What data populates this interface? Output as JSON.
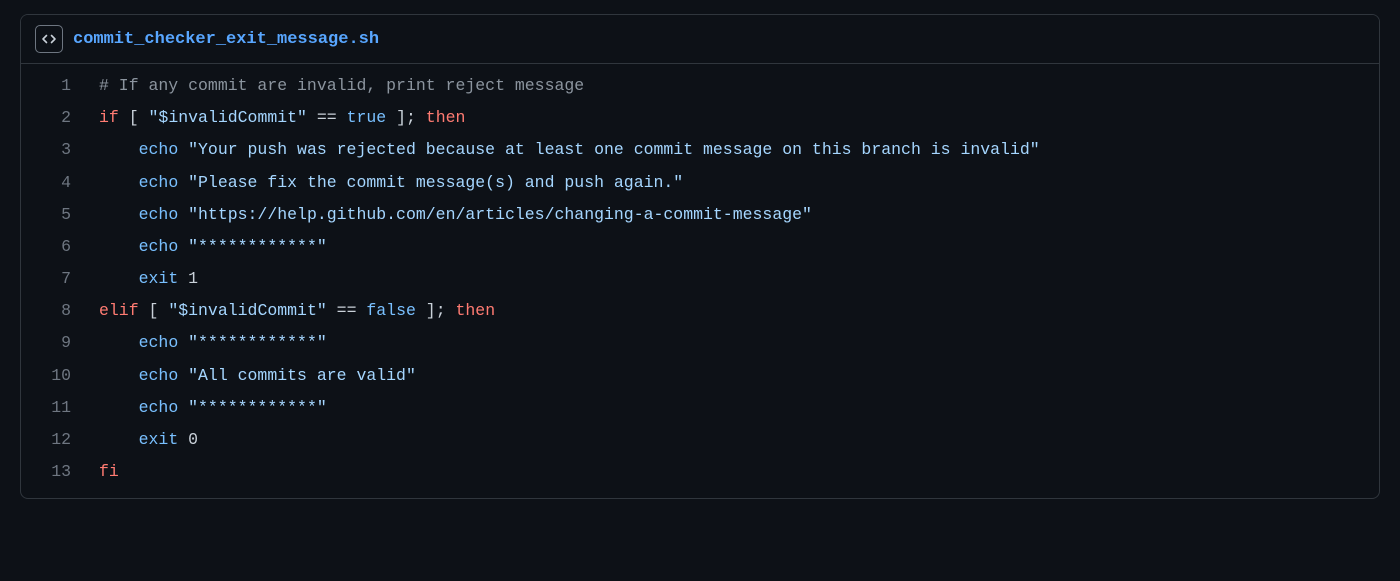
{
  "file": {
    "name": "commit_checker_exit_message.sh"
  },
  "code": {
    "lines": [
      {
        "n": "1",
        "tokens": [
          {
            "cls": "tok-comment",
            "text": "# If any commit are invalid, print reject message"
          }
        ]
      },
      {
        "n": "2",
        "tokens": [
          {
            "cls": "tok-kw",
            "text": "if"
          },
          {
            "cls": "tok-plain",
            "text": " [ "
          },
          {
            "cls": "tok-str",
            "text": "\"$invalidCommit\""
          },
          {
            "cls": "tok-plain",
            "text": " == "
          },
          {
            "cls": "tok-const",
            "text": "true"
          },
          {
            "cls": "tok-plain",
            "text": " ]; "
          },
          {
            "cls": "tok-kw",
            "text": "then"
          }
        ]
      },
      {
        "n": "3",
        "tokens": [
          {
            "cls": "tok-plain",
            "text": "    "
          },
          {
            "cls": "tok-fn",
            "text": "echo"
          },
          {
            "cls": "tok-plain",
            "text": " "
          },
          {
            "cls": "tok-str",
            "text": "\"Your push was rejected because at least one commit message on this branch is invalid\""
          }
        ]
      },
      {
        "n": "4",
        "tokens": [
          {
            "cls": "tok-plain",
            "text": "    "
          },
          {
            "cls": "tok-fn",
            "text": "echo"
          },
          {
            "cls": "tok-plain",
            "text": " "
          },
          {
            "cls": "tok-str",
            "text": "\"Please fix the commit message(s) and push again.\""
          }
        ]
      },
      {
        "n": "5",
        "tokens": [
          {
            "cls": "tok-plain",
            "text": "    "
          },
          {
            "cls": "tok-fn",
            "text": "echo"
          },
          {
            "cls": "tok-plain",
            "text": " "
          },
          {
            "cls": "tok-str",
            "text": "\"https://help.github.com/en/articles/changing-a-commit-message\""
          }
        ]
      },
      {
        "n": "6",
        "tokens": [
          {
            "cls": "tok-plain",
            "text": "    "
          },
          {
            "cls": "tok-fn",
            "text": "echo"
          },
          {
            "cls": "tok-plain",
            "text": " "
          },
          {
            "cls": "tok-str",
            "text": "\"************\""
          }
        ]
      },
      {
        "n": "7",
        "tokens": [
          {
            "cls": "tok-plain",
            "text": "    "
          },
          {
            "cls": "tok-fn",
            "text": "exit"
          },
          {
            "cls": "tok-plain",
            "text": " 1"
          }
        ]
      },
      {
        "n": "8",
        "tokens": [
          {
            "cls": "tok-kw",
            "text": "elif"
          },
          {
            "cls": "tok-plain",
            "text": " [ "
          },
          {
            "cls": "tok-str",
            "text": "\"$invalidCommit\""
          },
          {
            "cls": "tok-plain",
            "text": " == "
          },
          {
            "cls": "tok-const",
            "text": "false"
          },
          {
            "cls": "tok-plain",
            "text": " ]; "
          },
          {
            "cls": "tok-kw",
            "text": "then"
          }
        ]
      },
      {
        "n": "9",
        "tokens": [
          {
            "cls": "tok-plain",
            "text": "    "
          },
          {
            "cls": "tok-fn",
            "text": "echo"
          },
          {
            "cls": "tok-plain",
            "text": " "
          },
          {
            "cls": "tok-str",
            "text": "\"************\""
          }
        ]
      },
      {
        "n": "10",
        "tokens": [
          {
            "cls": "tok-plain",
            "text": "    "
          },
          {
            "cls": "tok-fn",
            "text": "echo"
          },
          {
            "cls": "tok-plain",
            "text": " "
          },
          {
            "cls": "tok-str",
            "text": "\"All commits are valid\""
          }
        ]
      },
      {
        "n": "11",
        "tokens": [
          {
            "cls": "tok-plain",
            "text": "    "
          },
          {
            "cls": "tok-fn",
            "text": "echo"
          },
          {
            "cls": "tok-plain",
            "text": " "
          },
          {
            "cls": "tok-str",
            "text": "\"************\""
          }
        ]
      },
      {
        "n": "12",
        "tokens": [
          {
            "cls": "tok-plain",
            "text": "    "
          },
          {
            "cls": "tok-fn",
            "text": "exit"
          },
          {
            "cls": "tok-plain",
            "text": " 0"
          }
        ]
      },
      {
        "n": "13",
        "tokens": [
          {
            "cls": "tok-kw",
            "text": "fi"
          }
        ]
      }
    ]
  }
}
